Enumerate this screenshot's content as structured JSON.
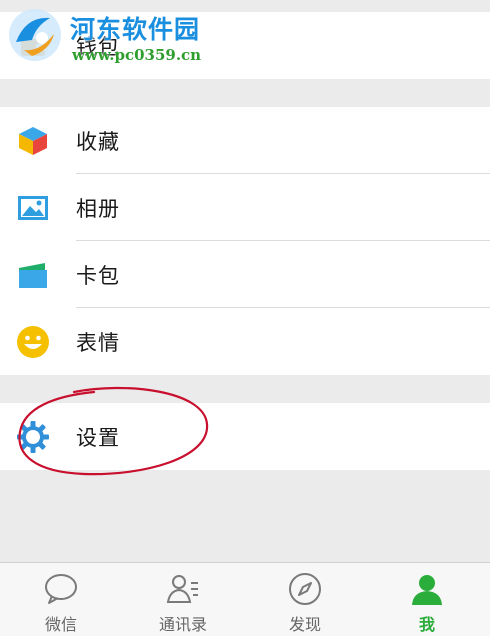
{
  "watermark": {
    "title": "河东软件园",
    "url": "www.pc0359.cn"
  },
  "menu": {
    "wallet": {
      "label": "钱包",
      "icon": "wallet-icon"
    },
    "favorites": {
      "label": "收藏",
      "icon": "cube-icon"
    },
    "album": {
      "label": "相册",
      "icon": "picture-icon"
    },
    "cards": {
      "label": "卡包",
      "icon": "card-wallet-icon"
    },
    "stickers": {
      "label": "表情",
      "icon": "smiley-icon"
    },
    "settings": {
      "label": "设置",
      "icon": "gear-icon"
    }
  },
  "tabbar": {
    "tabs": [
      {
        "label": "微信",
        "icon": "chat-bubble-icon",
        "active": false
      },
      {
        "label": "通讯录",
        "icon": "contacts-icon",
        "active": false
      },
      {
        "label": "发现",
        "icon": "compass-icon",
        "active": false
      },
      {
        "label": "我",
        "icon": "person-icon",
        "active": true
      }
    ]
  },
  "colors": {
    "accent_green": "#2bad3b",
    "annotation_red": "#c8102e",
    "watermark_blue": "#1a8fe0"
  }
}
